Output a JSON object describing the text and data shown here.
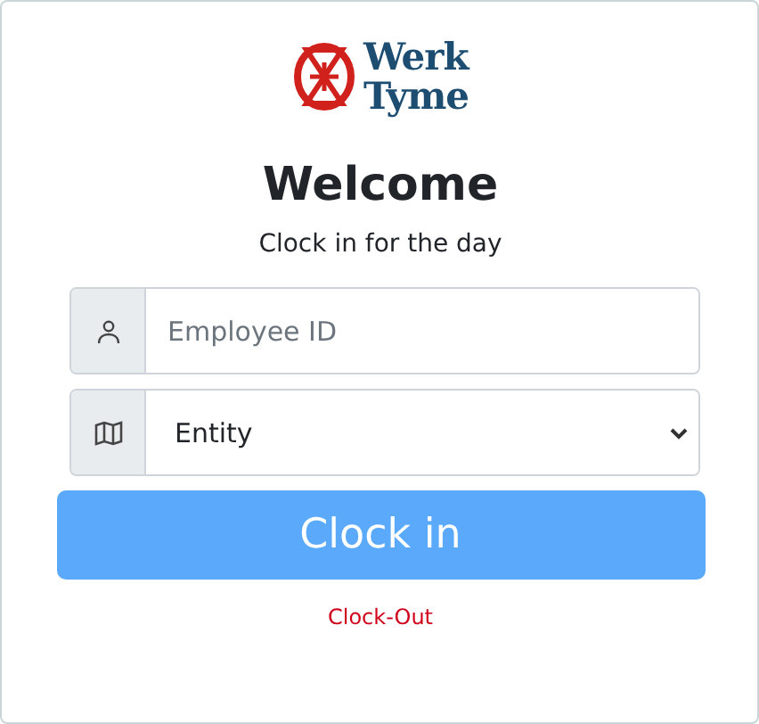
{
  "logo": {
    "lines": [
      "Werk",
      "Tyme"
    ]
  },
  "title": "Welcome",
  "subtitle": "Clock in for the day",
  "employee_field": {
    "placeholder": "Employee ID"
  },
  "entity_select": {
    "value": "Entity"
  },
  "clock_in_button": {
    "label": "Clock in",
    "disabled": true
  },
  "clock_out_link": "Clock-Out"
}
